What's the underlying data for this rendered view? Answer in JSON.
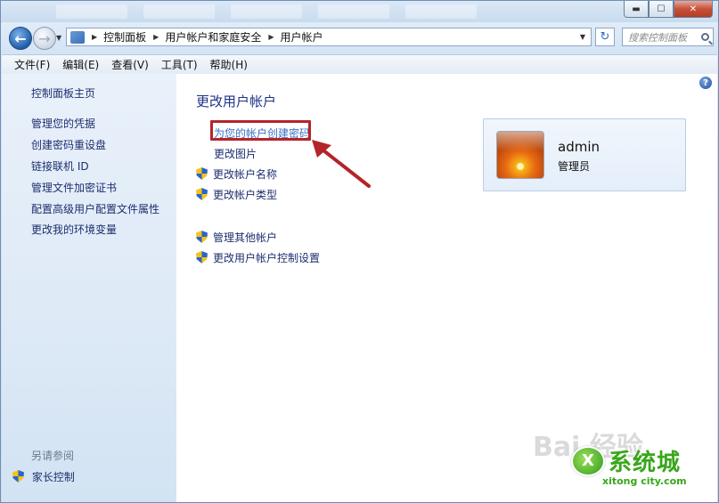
{
  "window": {
    "controls": {
      "minimize": "▬",
      "maximize": "☐",
      "close": "✕"
    }
  },
  "nav": {
    "back_icon": "arrow-left-icon",
    "forward_icon": "arrow-right-icon",
    "breadcrumb": [
      "控制面板",
      "用户帐户和家庭安全",
      "用户帐户"
    ],
    "search_placeholder": "搜索控制面板"
  },
  "menu": [
    "文件(F)",
    "编辑(E)",
    "查看(V)",
    "工具(T)",
    "帮助(H)"
  ],
  "sidebar": {
    "links": [
      "控制面板主页",
      "管理您的凭据",
      "创建密码重设盘",
      "链接联机 ID",
      "管理文件加密证书",
      "配置高级用户配置文件属性",
      "更改我的环境变量"
    ],
    "see_also_title": "另请参阅",
    "see_also_link": "家长控制"
  },
  "main": {
    "title": "更改用户帐户",
    "tasks": [
      {
        "label": "为您的帐户创建密码",
        "shield": false,
        "highlight": true
      },
      {
        "label": "更改图片",
        "shield": false,
        "highlight": false
      },
      {
        "label": "更改帐户名称",
        "shield": true,
        "highlight": false
      },
      {
        "label": "更改帐户类型",
        "shield": true,
        "highlight": false
      },
      {
        "label": "管理其他帐户",
        "shield": true,
        "highlight": false
      },
      {
        "label": "更改用户帐户控制设置",
        "shield": true,
        "highlight": false
      }
    ]
  },
  "account": {
    "name": "admin",
    "role": "管理员"
  },
  "watermark": {
    "baidu": "Bai 经验",
    "site_name": "系统城",
    "site_logo": "X",
    "url": "xitong city.com"
  },
  "colors": {
    "link": "#1d2e6e",
    "title": "#1e3287",
    "annotation_red": "#b3252a",
    "close_button": "#c6513a"
  }
}
